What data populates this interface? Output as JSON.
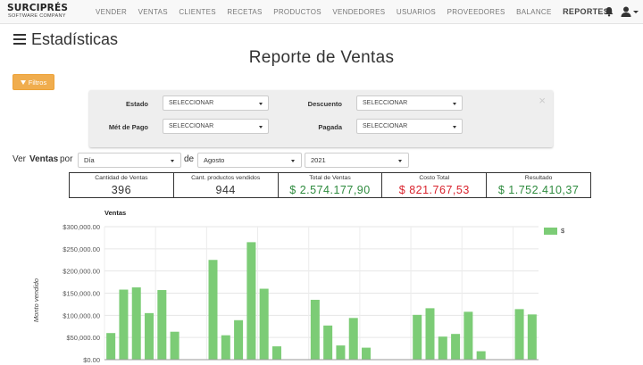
{
  "logo": {
    "main": "SURCIPRÉS",
    "sub": "SOFTWARE COMPANY"
  },
  "nav": {
    "items": [
      "VENDER",
      "VENTAS",
      "CLIENTES",
      "RECETAS",
      "PRODUCTOS",
      "VENDEDORES",
      "USUARIOS",
      "PROVEEDORES",
      "BALANCE",
      "REPORTES"
    ],
    "active": "REPORTES"
  },
  "icons": {
    "bell": "bell-icon",
    "user": "user-icon",
    "menu": "hamburger-icon",
    "filter": "funnel-icon",
    "close": "close-icon"
  },
  "page": {
    "title": "Estadísticas",
    "report_title": "Reporte de Ventas"
  },
  "filters": {
    "button_label": "Filtros",
    "estado_label": "Estado",
    "estado_value": "SELECCIONAR",
    "descuento_label": "Descuento",
    "descuento_value": "SELECCIONAR",
    "met_pago_label": "Mét de Pago",
    "met_pago_value": "SELECCIONAR",
    "pagada_label": "Pagada",
    "pagada_value": "SELECCIONAR",
    "close": "×"
  },
  "view": {
    "ver": "Ver",
    "ventas": "Ventas",
    "por": "por",
    "de": "de",
    "period": "Día",
    "month": "Agosto",
    "year": "2021"
  },
  "summary": [
    {
      "label": "Cantidad de Ventas",
      "value": "396",
      "color": "#333333"
    },
    {
      "label": "Cant. productos vendidos",
      "value": "944",
      "color": "#333333"
    },
    {
      "label": "Total de Ventas",
      "value": "$ 2.574.177,90",
      "color": "#2e8b3e"
    },
    {
      "label": "Costo Total",
      "value": "$ 821.767,53",
      "color": "#d9232d"
    },
    {
      "label": "Resultado",
      "value": "$ 1.752.410,37",
      "color": "#2e8b3e"
    }
  ],
  "chart_data": {
    "type": "bar",
    "title": "Ventas",
    "ylabel": "Monto vendido",
    "ylim": [
      0,
      300000
    ],
    "yticks": [
      "$0.00",
      "$50,000.00",
      "$100,000.00",
      "$150,000.00",
      "$200,000.00",
      "$250,000.00",
      "$300,000.00"
    ],
    "legend": "$",
    "color": "#7ccc76",
    "values": [
      60000,
      158000,
      163000,
      105000,
      157000,
      63000,
      0,
      0,
      225000,
      55000,
      89000,
      265000,
      160000,
      30000,
      0,
      0,
      135000,
      77000,
      32000,
      94000,
      27000,
      0,
      0,
      0,
      101000,
      116000,
      52000,
      58000,
      108000,
      19000,
      0,
      0,
      114000,
      102000
    ]
  }
}
